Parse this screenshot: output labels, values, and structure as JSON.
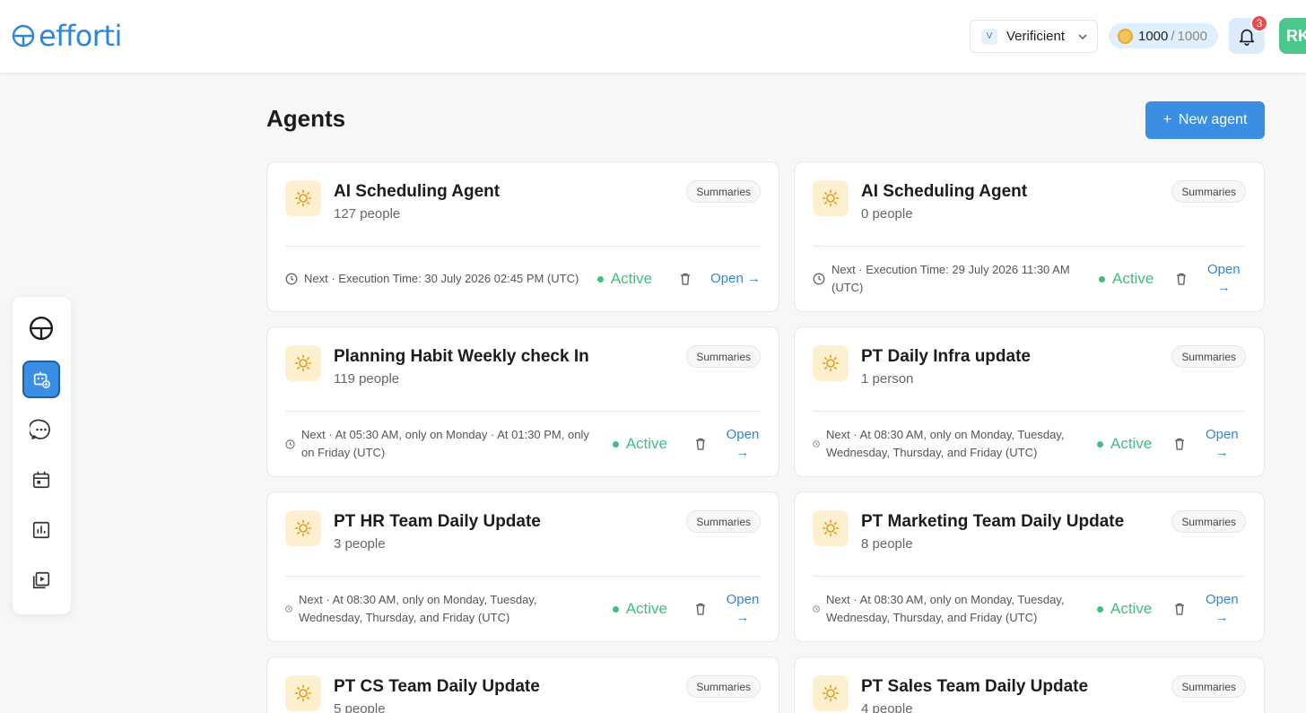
{
  "header": {
    "logo_text": "efforti",
    "org": {
      "badge": "V",
      "name": "Verificient"
    },
    "credits": {
      "used": "1000",
      "separator": "/",
      "total": "1000"
    },
    "notifications": {
      "count": "3"
    },
    "avatar_initials": "RK"
  },
  "sidebar": {
    "items": [
      {
        "name": "sidebar-item-logo",
        "icon": "logo-icon"
      },
      {
        "name": "sidebar-item-agents",
        "icon": "robot-icon",
        "active": true
      },
      {
        "name": "sidebar-item-chat",
        "icon": "chat-icon"
      },
      {
        "name": "sidebar-item-calendar",
        "icon": "calendar-icon"
      },
      {
        "name": "sidebar-item-reports",
        "icon": "bar-chart-icon"
      },
      {
        "name": "sidebar-item-media",
        "icon": "video-library-icon"
      }
    ]
  },
  "page": {
    "title": "Agents",
    "new_agent_plus": "+",
    "new_agent_label": "New agent"
  },
  "cards": [
    {
      "title": "AI Scheduling Agent",
      "people": "127 people",
      "summaries": "Summaries",
      "next": "Next · Execution Time: 30 July 2026 02:45 PM (UTC)",
      "status": "Active",
      "open_label": "Open",
      "open_arrow": "→"
    },
    {
      "title": "AI Scheduling Agent",
      "people": "0 people",
      "summaries": "Summaries",
      "next": "Next · Execution Time: 29 July 2026 11:30 AM (UTC)",
      "status": "Active",
      "open_label": "Open",
      "open_arrow": "→"
    },
    {
      "title": "Planning Habit Weekly check In",
      "people": "119 people",
      "summaries": "Summaries",
      "next": "Next · At 05:30 AM, only on Monday · At 01:30 PM, only on Friday (UTC)",
      "status": "Active",
      "open_label": "Open",
      "open_arrow": "→"
    },
    {
      "title": "PT Daily Infra update",
      "people": "1 person",
      "summaries": "Summaries",
      "next": "Next · At 08:30 AM, only on Monday, Tuesday, Wednesday, Thursday, and Friday (UTC)",
      "status": "Active",
      "open_label": "Open",
      "open_arrow": "→"
    },
    {
      "title": "PT HR Team Daily Update",
      "people": "3 people",
      "summaries": "Summaries",
      "next": "Next · At 08:30 AM, only on Monday, Tuesday, Wednesday, Thursday, and Friday (UTC)",
      "status": "Active",
      "open_label": "Open",
      "open_arrow": "→"
    },
    {
      "title": "PT Marketing Team Daily Update",
      "people": "8 people",
      "summaries": "Summaries",
      "next": "Next · At 08:30 AM, only on Monday, Tuesday, Wednesday, Thursday, and Friday (UTC)",
      "status": "Active",
      "open_label": "Open",
      "open_arrow": "→"
    },
    {
      "title": "PT CS Team Daily Update",
      "people": "5 people",
      "summaries": "Summaries"
    },
    {
      "title": "PT Sales Team Daily Update",
      "people": "4 people",
      "summaries": "Summaries"
    }
  ],
  "colors": {
    "accent": "#3a8ee4",
    "active_green": "#3fbf7f",
    "icon_bg": "#fdf0cf",
    "icon_fg": "#e39a1b"
  }
}
